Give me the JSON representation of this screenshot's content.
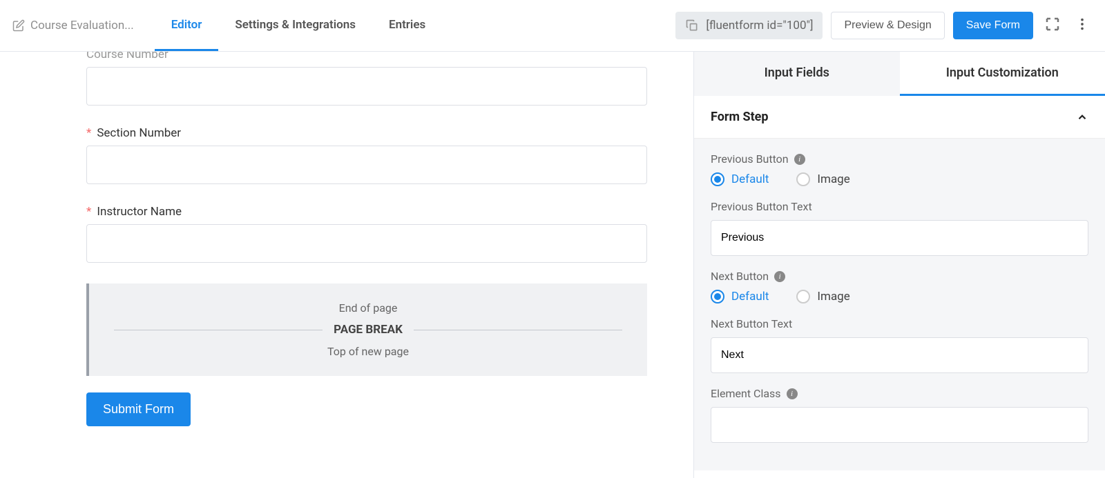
{
  "header": {
    "formTitle": "Course Evaluation...",
    "tabs": {
      "editor": "Editor",
      "settings": "Settings & Integrations",
      "entries": "Entries"
    },
    "shortcode": "[fluentform id=\"100\"]",
    "previewBtn": "Preview & Design",
    "saveBtn": "Save Form"
  },
  "editor": {
    "fields": {
      "courseNumber": "Course Number",
      "sectionNumber": "Section Number",
      "instructorName": "Instructor Name"
    },
    "pageBreak": {
      "endOfPage": "End of page",
      "pageBreak": "PAGE BREAK",
      "topOfNewPage": "Top of new page"
    },
    "submitBtn": "Submit Form"
  },
  "sidebar": {
    "tabs": {
      "inputFields": "Input Fields",
      "inputCustomization": "Input Customization"
    },
    "panel": {
      "title": "Form Step"
    },
    "options": {
      "previousButton": "Previous Button",
      "previousButtonText": "Previous Button Text",
      "previousValue": "Previous",
      "nextButton": "Next Button",
      "nextButtonText": "Next Button Text",
      "nextValue": "Next",
      "elementClass": "Element Class",
      "elementClassValue": "",
      "radioDefault": "Default",
      "radioImage": "Image"
    }
  }
}
